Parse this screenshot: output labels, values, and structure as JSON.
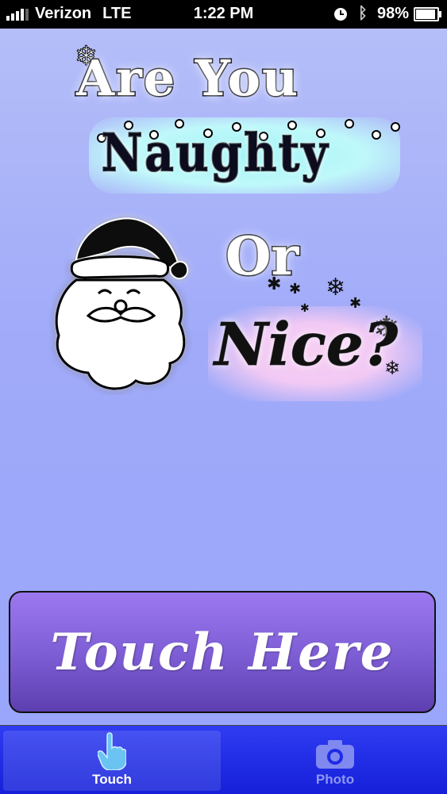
{
  "status_bar": {
    "carrier": "Verizon",
    "network": "LTE",
    "time": "1:22 PM",
    "battery_percent": "98%",
    "battery_level": 0.98,
    "icons": [
      "signal-bars-icon",
      "alarm-clock-icon",
      "bluetooth-icon",
      "battery-icon"
    ]
  },
  "title": {
    "line1": "Are You",
    "line2": "Naughty",
    "line3": "Or",
    "line4": "Nice?"
  },
  "main": {
    "button_label": "Touch Here"
  },
  "tabs": [
    {
      "label": "Touch",
      "icon": "pointing-hand-icon",
      "active": true
    },
    {
      "label": "Photo",
      "icon": "camera-icon",
      "active": false
    }
  ],
  "colors": {
    "background": "#a0aaf9",
    "button_top": "#9c78f0",
    "button_bottom": "#5d3fb0",
    "tab_bar": "#1f2be6",
    "tab_active_text": "#ffffff",
    "tab_inactive_text": "#8f97f4"
  }
}
